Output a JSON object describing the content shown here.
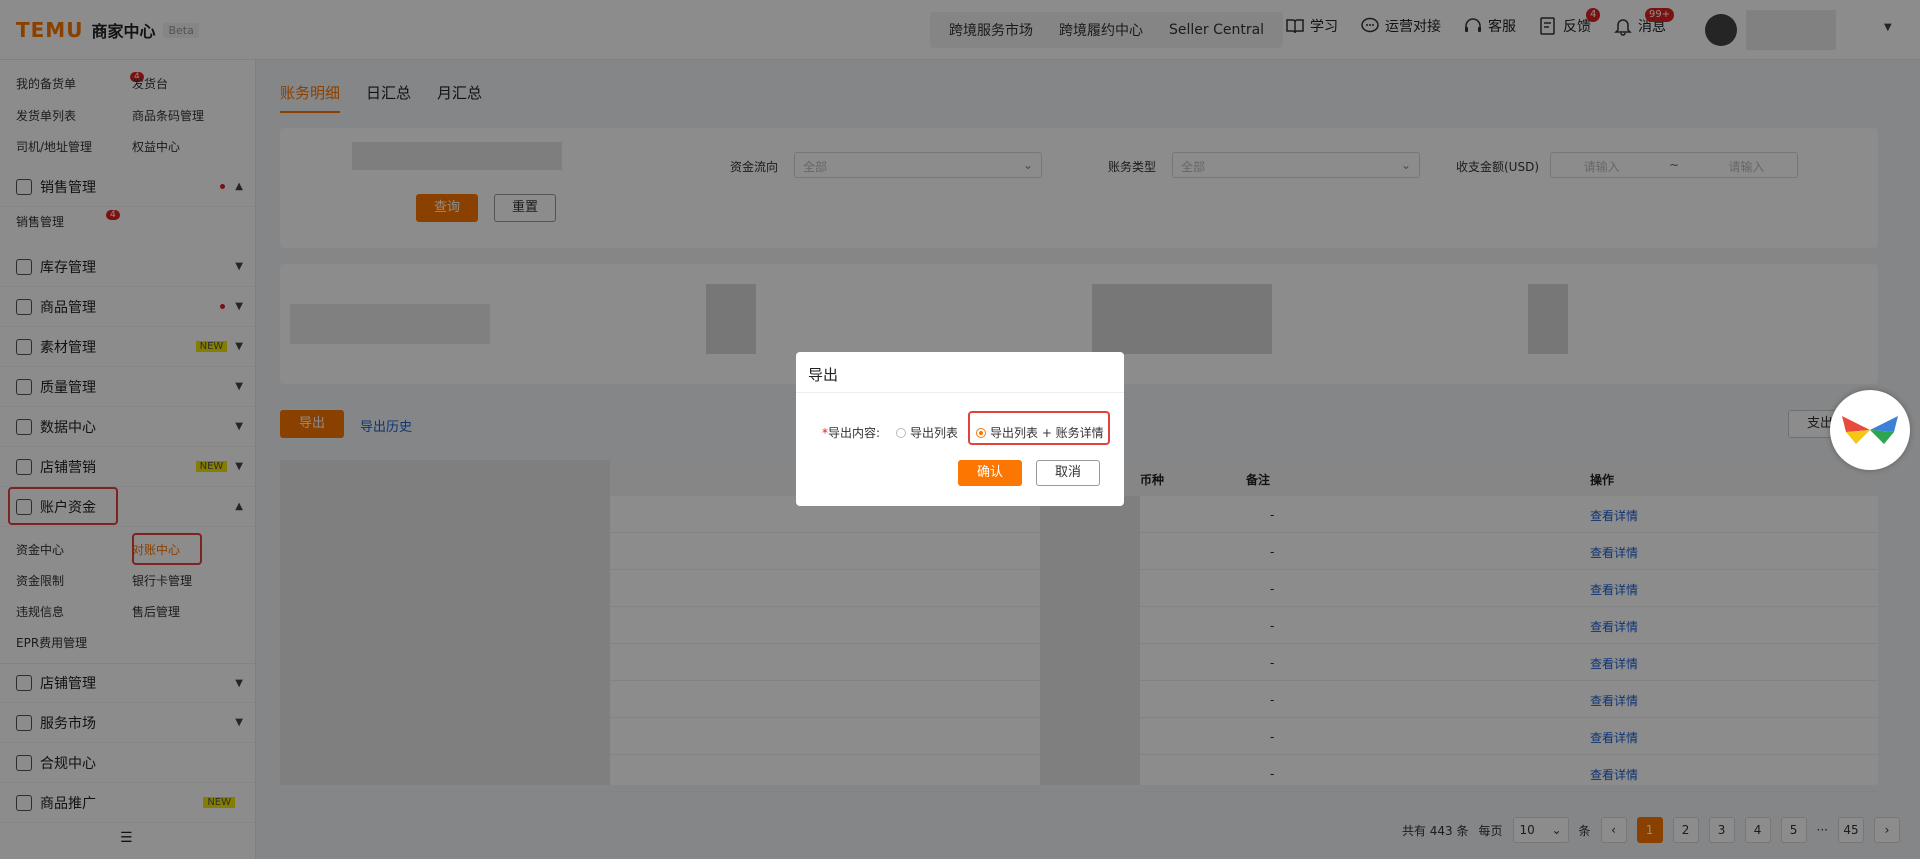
{
  "header": {
    "brand": "TEMU",
    "title": "商家中心",
    "beta": "Beta",
    "nav": [
      "跨境服务市场",
      "跨境履约中心",
      "Seller Central"
    ],
    "icons": [
      {
        "label": "学习",
        "icon": "book-icon"
      },
      {
        "label": "运营对接",
        "icon": "chat-icon"
      },
      {
        "label": "客服",
        "icon": "headset-icon"
      },
      {
        "label": "反馈",
        "icon": "feedback-icon",
        "badge": "4"
      },
      {
        "label": "消息",
        "icon": "bell-icon",
        "badge": "99+"
      }
    ]
  },
  "sidebar": {
    "top_sub": [
      {
        "label": "我的备货单",
        "badge": "4"
      },
      {
        "label": "发货台"
      },
      {
        "label": "发货单列表"
      },
      {
        "label": "商品条码管理"
      },
      {
        "label": "司机/地址管理"
      },
      {
        "label": "权益中心"
      }
    ],
    "sales": {
      "label": "销售管理",
      "sub": "销售管理",
      "sub_badge": "4"
    },
    "menus": [
      {
        "label": "库存管理"
      },
      {
        "label": "商品管理"
      },
      {
        "label": "素材管理",
        "tag": "NEW"
      },
      {
        "label": "质量管理"
      },
      {
        "label": "数据中心"
      },
      {
        "label": "店铺营销",
        "tag": "NEW"
      }
    ],
    "account": {
      "label": "账户资金",
      "sub": [
        "资金中心",
        "对账中心",
        "资金限制",
        "银行卡管理",
        "违规信息",
        "售后管理",
        "EPR费用管理"
      ]
    },
    "bottom": [
      {
        "label": "店铺管理"
      },
      {
        "label": "服务市场"
      },
      {
        "label": "合规中心"
      },
      {
        "label": "商品推广",
        "tag": "NEW"
      }
    ]
  },
  "tabs": [
    "账务明细",
    "日汇总",
    "月汇总"
  ],
  "filter": {
    "flow_label": "资金流向",
    "flow_value": "全部",
    "type_label": "账务类型",
    "type_value": "全部",
    "amount_label": "收支金额(USD)",
    "min_ph": "请输入",
    "sep": "~",
    "max_ph": "请输入",
    "query": "查询",
    "reset": "重置"
  },
  "actions": {
    "export": "导出",
    "history": "导出历史",
    "right": "支出"
  },
  "table": {
    "headers": [
      "币种",
      "备注",
      "操作"
    ],
    "rows": [
      "-",
      "-",
      "-",
      "-",
      "-",
      "-",
      "-",
      "-"
    ],
    "link": "查看详情"
  },
  "pager": {
    "total": "共有 443 条",
    "per": "每页",
    "size": "10",
    "unit": "条",
    "pages": [
      "1",
      "2",
      "3",
      "4",
      "5",
      "···",
      "45"
    ],
    "current": "1"
  },
  "modal": {
    "title": "导出",
    "label": "导出内容:",
    "opt1": "导出列表",
    "opt2": "导出列表 + 账务详情",
    "confirm": "确认",
    "cancel": "取消"
  }
}
